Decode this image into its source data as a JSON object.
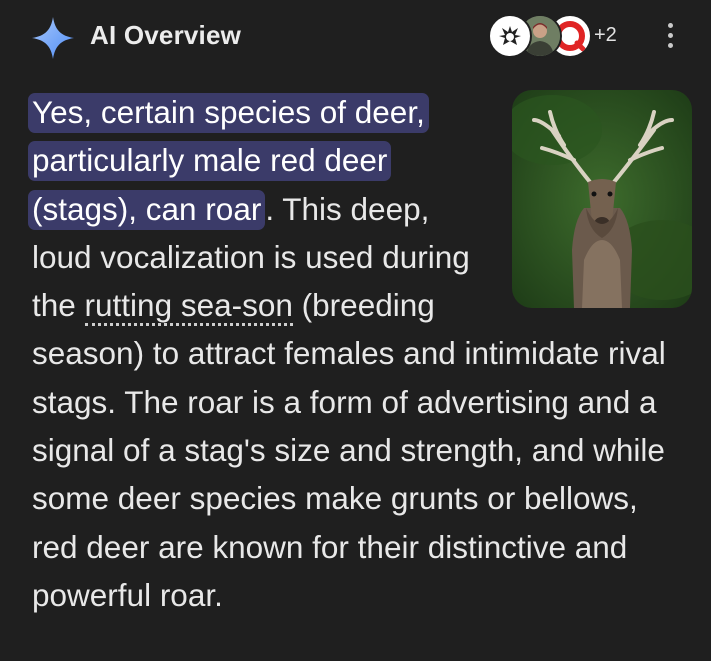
{
  "header": {
    "title": "AI Overview",
    "sparkle_icon": "gemini-sparkle-icon",
    "sources": [
      {
        "icon": "deer-crest-logo-icon"
      },
      {
        "icon": "person-avatar-icon"
      },
      {
        "icon": "red-ring-logo-icon"
      }
    ],
    "more_sources": "+2",
    "menu_icon": "more-vertical-icon"
  },
  "image": {
    "subject": "red-deer-stag-photo"
  },
  "answer": {
    "highlight": "Yes, certain species of deer, particularly male red deer (stags), can roar",
    "after_highlight": ". This deep, loud vocalization is used during the ",
    "term": "rutting sea-son",
    "rest": " (breeding season) to attract females and intimidate rival stags. The roar is a form of advertising and a signal of a stag's size and strength, and while some deer species make grunts or bellows, red deer are known for their distinctive and powerful roar."
  },
  "colors": {
    "background": "#1f1f1f",
    "text": "#e8e8e8",
    "highlight_bg": "#3b3b69",
    "sparkle_blue": "#8ab4f8"
  }
}
